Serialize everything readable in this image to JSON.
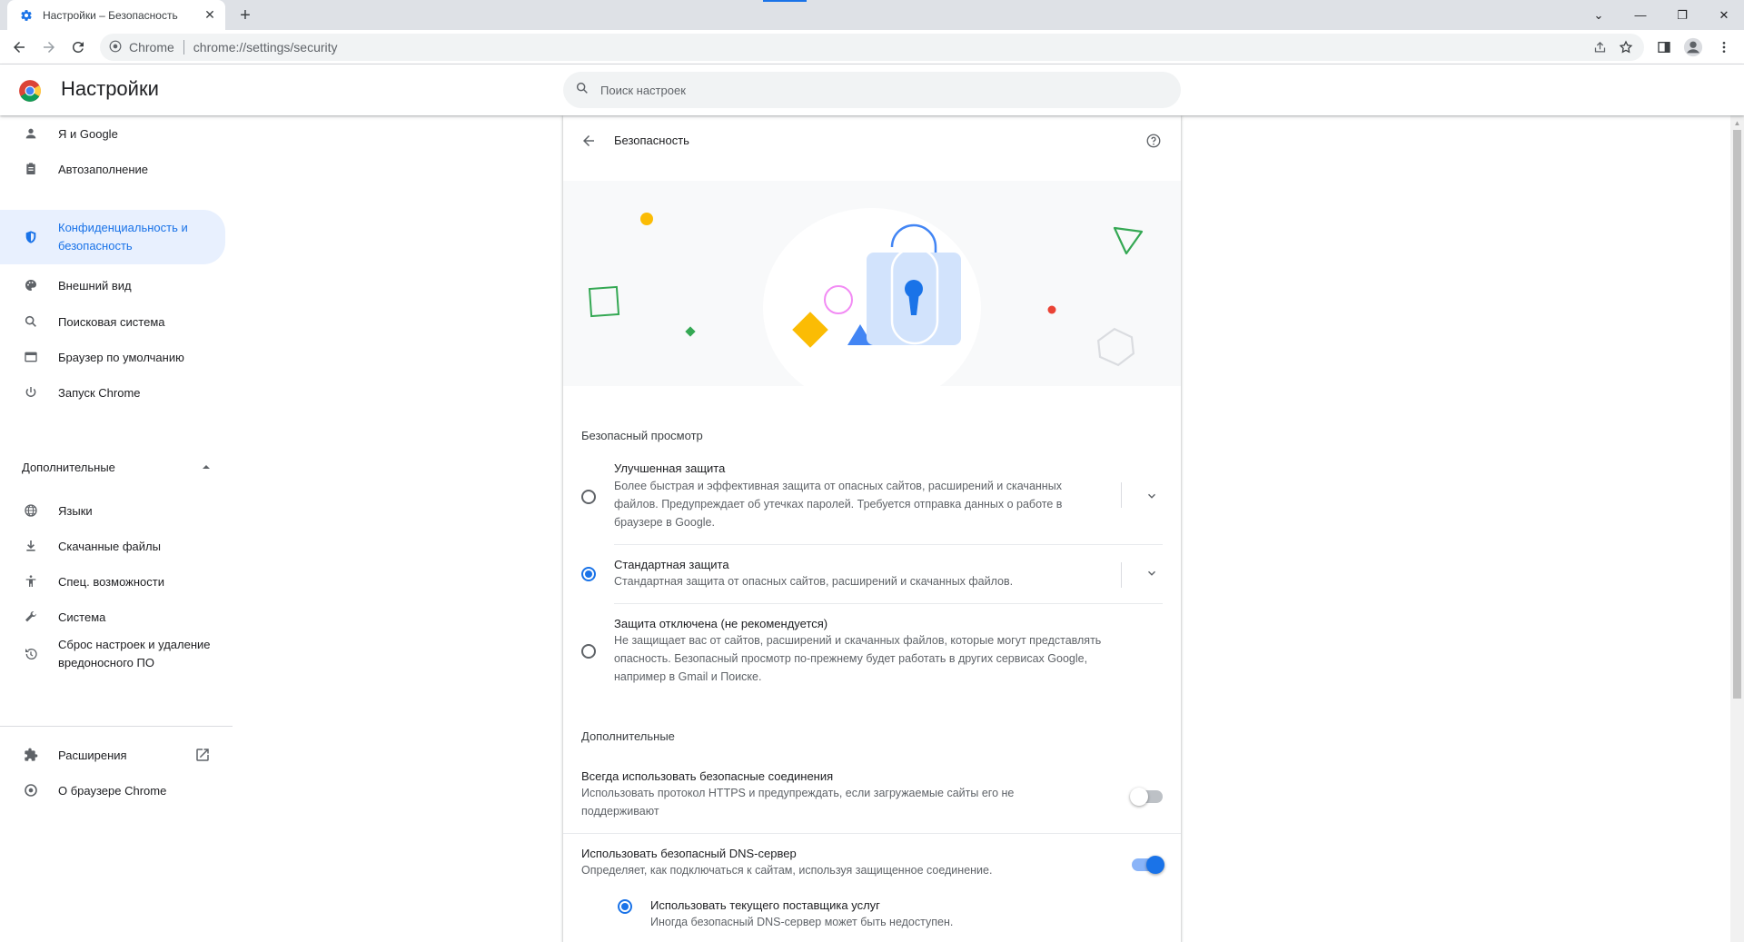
{
  "tab": {
    "title": "Настройки – Безопасность",
    "close": "✕",
    "new": "+"
  },
  "window": {
    "dropdown": "⌄",
    "minimize": "—",
    "restore": "❐",
    "close": "✕"
  },
  "omnibox": {
    "site": "Chrome",
    "url": "chrome://settings/security"
  },
  "header": {
    "title": "Настройки",
    "search_placeholder": "Поиск настроек"
  },
  "sidebar": {
    "items": [
      {
        "label": "Я и Google",
        "icon": "person-icon"
      },
      {
        "label": "Автозаполнение",
        "icon": "clipboard-icon"
      },
      {
        "label": "Конфиденциальность и безопасность",
        "icon": "shield-icon",
        "active": true
      },
      {
        "label": "Внешний вид",
        "icon": "palette-icon"
      },
      {
        "label": "Поисковая система",
        "icon": "search-icon"
      },
      {
        "label": "Браузер по умолчанию",
        "icon": "browser-icon"
      },
      {
        "label": "Запуск Chrome",
        "icon": "power-icon"
      }
    ],
    "advanced_label": "Дополнительные",
    "advanced_items": [
      {
        "label": "Языки",
        "icon": "globe-icon"
      },
      {
        "label": "Скачанные файлы",
        "icon": "download-icon"
      },
      {
        "label": "Спец. возможности",
        "icon": "accessibility-icon"
      },
      {
        "label": "Система",
        "icon": "wrench-icon"
      },
      {
        "label": "Сброс настроек и удаление вредоносного ПО",
        "icon": "restore-icon"
      }
    ],
    "extensions_label": "Расширения",
    "about_label": "О браузере Chrome"
  },
  "page": {
    "title": "Безопасность",
    "safe_browsing_header": "Безопасный просмотр",
    "options": [
      {
        "title": "Улучшенная защита",
        "desc": "Более быстрая и эффективная защита от опасных сайтов, расширений и скачанных файлов. Предупреждает об утечках паролей. Требуется отправка данных о работе в браузере в Google.",
        "selected": false
      },
      {
        "title": "Стандартная защита",
        "desc": "Стандартная защита от опасных сайтов, расширений и скачанных файлов.",
        "selected": true
      },
      {
        "title": "Защита отключена (не рекомендуется)",
        "desc": "Не защищает вас от сайтов, расширений и скачанных файлов, которые могут представлять опасность. Безопасный просмотр по-прежнему будет работать в других сервисах Google, например в Gmail и Поиске.",
        "selected": false
      }
    ],
    "advanced_header": "Дополнительные",
    "https": {
      "title": "Всегда использовать безопасные соединения",
      "desc": "Использовать протокол HTTPS и предупреждать, если загружаемые сайты его не поддерживают",
      "enabled": false
    },
    "dns": {
      "title": "Использовать безопасный DNS-сервер",
      "desc": "Определяет, как подключаться к сайтам, используя защищенное соединение.",
      "enabled": true
    },
    "dns_option": {
      "title": "Использовать текущего поставщика услуг",
      "desc": "Иногда безопасный DNS-сервер может быть недоступен.",
      "selected": true
    }
  },
  "colors": {
    "accent": "#1a73e8",
    "active_bg": "#e8f0fe"
  }
}
